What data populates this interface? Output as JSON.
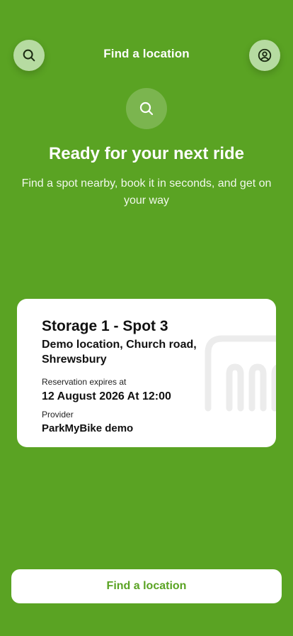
{
  "header": {
    "title": "Find a location"
  },
  "icons": {
    "left_button": "search-icon",
    "right_button": "user-circle-icon",
    "hero": "search-icon",
    "card_background": "bike-rack-icon"
  },
  "hero": {
    "title": "Ready for your next ride",
    "subtitle": "Find a spot nearby, book it in seconds, and get on your way"
  },
  "reservation": {
    "spot_name": "Storage 1 - Spot 3",
    "location": "Demo location, Church road, Shrewsbury",
    "expires_label": "Reservation expires at",
    "expires_value": "12 August 2026 At 12:00",
    "provider_label": "Provider",
    "provider_value": "ParkMyBike demo"
  },
  "footer": {
    "button_label": "Find a location"
  },
  "colors": {
    "background": "#5aa323",
    "accent": "#5aa323",
    "icon_button": "#b6dba1",
    "card": "#ffffff"
  }
}
